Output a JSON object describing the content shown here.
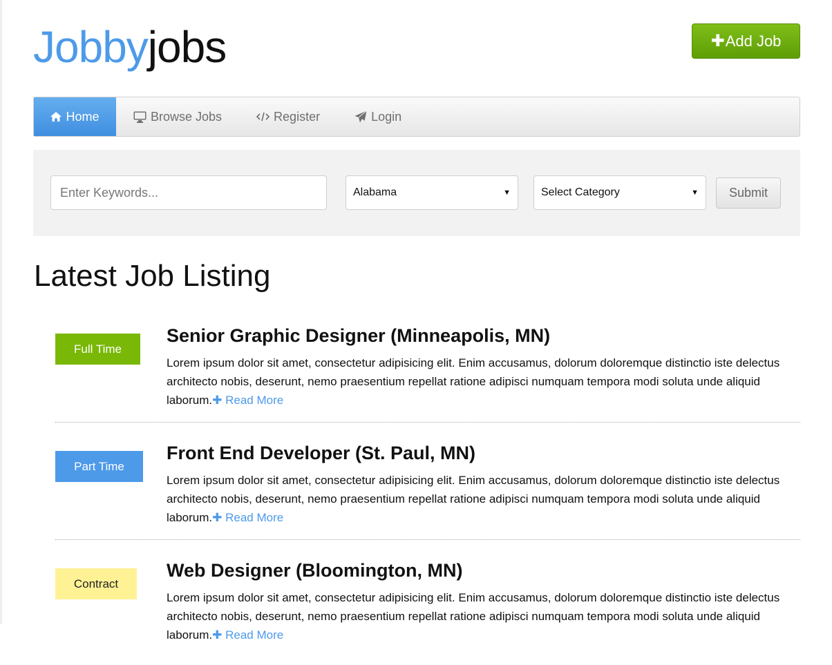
{
  "brand": {
    "part1": "Jobby",
    "part2": "jobs"
  },
  "header": {
    "add_job_label": "Add Job"
  },
  "nav": {
    "items": [
      {
        "label": "Home",
        "icon": "home-icon",
        "active": true
      },
      {
        "label": "Browse Jobs",
        "icon": "monitor-icon",
        "active": false
      },
      {
        "label": "Register",
        "icon": "code-icon",
        "active": false
      },
      {
        "label": "Login",
        "icon": "paper-plane-icon",
        "active": false
      }
    ]
  },
  "search": {
    "keywords_placeholder": "Enter Keywords...",
    "keywords_value": "",
    "state_selected": "Alabama",
    "category_selected": "Select Category",
    "submit_label": "Submit"
  },
  "listing": {
    "title": "Latest Job Listing",
    "read_more_label": "Read More",
    "jobs": [
      {
        "type": "Full Time",
        "title": "Senior Graphic Designer (Minneapolis, MN)",
        "description": "Lorem ipsum dolor sit amet, consectetur adipisicing elit. Enim accusamus, dolorum doloremque distinctio iste delectus architecto nobis, deserunt, nemo praesentium repellat ratione adipisci numquam tempora modi soluta unde aliquid laborum."
      },
      {
        "type": "Part Time",
        "title": "Front End Developer (St. Paul, MN)",
        "description": "Lorem ipsum dolor sit amet, consectetur adipisicing elit. Enim accusamus, dolorum doloremque distinctio iste delectus architecto nobis, deserunt, nemo praesentium repellat ratione adipisci numquam tempora modi soluta unde aliquid laborum."
      },
      {
        "type": "Contract",
        "title": "Web Designer (Bloomington, MN)",
        "description": "Lorem ipsum dolor sit amet, consectetur adipisicing elit. Enim accusamus, dolorum doloremque distinctio iste delectus architecto nobis, deserunt, nemo praesentium repellat ratione adipisci numquam tempora modi soluta unde aliquid laborum."
      }
    ]
  },
  "colors": {
    "brand_blue": "#4d9ae9",
    "add_job_green": "#6aac0c",
    "full_time": "#79b806",
    "part_time": "#4d9ae9",
    "contract": "#fff294"
  }
}
